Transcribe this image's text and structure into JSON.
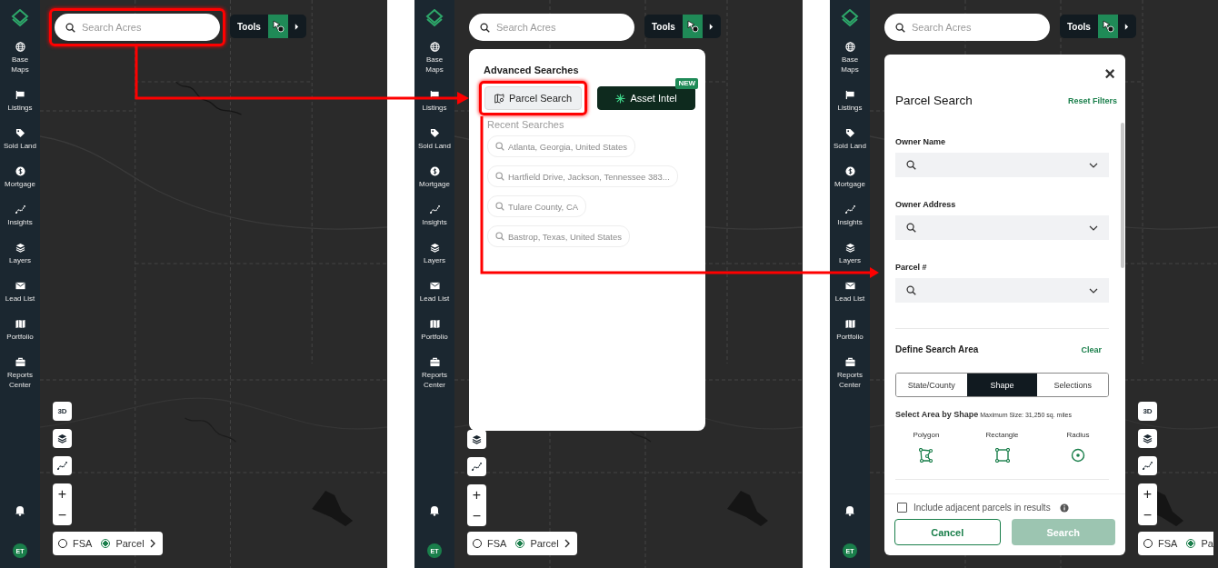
{
  "panels": [
    {
      "sidebar": {
        "items": [
          {
            "kind": "globe",
            "label": "Base Maps"
          },
          {
            "kind": "flag",
            "label": "Listings"
          },
          {
            "kind": "tag",
            "label": "Sold Land"
          },
          {
            "kind": "dollar",
            "label": "Mortgage"
          },
          {
            "kind": "insights",
            "label": "Insights"
          },
          {
            "kind": "layers",
            "label": "Layers"
          },
          {
            "kind": "mail",
            "label": "Lead List"
          },
          {
            "kind": "map",
            "label": "Portfolio"
          },
          {
            "kind": "briefcase",
            "label": "Reports Center"
          }
        ],
        "avatar": "ET"
      },
      "search": {
        "placeholder": "Search Acres",
        "highlighted": true
      },
      "tools": {
        "label": "Tools"
      },
      "map_controls": [
        {
          "kind": "perspective",
          "label": "3D"
        },
        {
          "kind": "layers"
        },
        {
          "kind": "insights"
        },
        {
          "kind": "zoom",
          "plus": "+",
          "minus": "−"
        }
      ],
      "layer_toggle": [
        {
          "label": "FSA",
          "selected": false,
          "chevron": false
        },
        {
          "label": "Parcel",
          "selected": true,
          "chevron": true
        }
      ]
    },
    {
      "sidebar": {
        "items": [
          {
            "kind": "globe",
            "label": "Base Maps"
          },
          {
            "kind": "flag",
            "label": "Listings"
          },
          {
            "kind": "tag",
            "label": "Sold Land"
          },
          {
            "kind": "dollar",
            "label": "Mortgage"
          },
          {
            "kind": "insights",
            "label": "Insights"
          },
          {
            "kind": "layers",
            "label": "Layers"
          },
          {
            "kind": "mail",
            "label": "Lead List"
          },
          {
            "kind": "map",
            "label": "Portfolio"
          },
          {
            "kind": "briefcase",
            "label": "Reports Center"
          }
        ],
        "avatar": "ET"
      },
      "search": {
        "placeholder": "Search Acres",
        "highlighted": false
      },
      "tools": {
        "label": "Tools"
      },
      "map_controls": [
        {
          "kind": "layers"
        },
        {
          "kind": "insights"
        },
        {
          "kind": "zoom",
          "plus": "+",
          "minus": "−"
        }
      ],
      "layer_toggle": [
        {
          "label": "FSA",
          "selected": false,
          "chevron": false
        },
        {
          "label": "Parcel",
          "selected": true,
          "chevron": true
        }
      ],
      "dropdown": {
        "title": "Advanced Searches",
        "buttons": [
          {
            "kind": "parcel",
            "label": "Parcel Search",
            "highlighted": true
          },
          {
            "kind": "asset",
            "label": "Asset Intel",
            "badge": "NEW",
            "highlighted": false
          }
        ],
        "recent_title": "Recent Searches",
        "recent": [
          "Atlanta, Georgia, United States",
          "Hartfield Drive, Jackson, Tennessee 383...",
          "Tulare County, CA",
          "Bastrop, Texas, United States"
        ]
      }
    },
    {
      "sidebar": {
        "items": [
          {
            "kind": "globe",
            "label": "Base Maps"
          },
          {
            "kind": "flag",
            "label": "Listings"
          },
          {
            "kind": "tag",
            "label": "Sold Land"
          },
          {
            "kind": "dollar",
            "label": "Mortgage"
          },
          {
            "kind": "insights",
            "label": "Insights"
          },
          {
            "kind": "layers",
            "label": "Layers"
          },
          {
            "kind": "mail",
            "label": "Lead List"
          },
          {
            "kind": "map",
            "label": "Portfolio"
          },
          {
            "kind": "briefcase",
            "label": "Reports Center"
          }
        ],
        "avatar": "ET"
      },
      "search": {
        "placeholder": "Search Acres",
        "highlighted": false
      },
      "tools": {
        "label": "Tools"
      },
      "map_controls": [
        {
          "kind": "perspective",
          "label": "3D"
        },
        {
          "kind": "layers"
        },
        {
          "kind": "insights"
        },
        {
          "kind": "zoom",
          "plus": "+",
          "minus": "−"
        }
      ],
      "layer_toggle": [
        {
          "label": "FSA",
          "selected": false,
          "chevron": false
        },
        {
          "label": "Pa",
          "selected": true,
          "chevron": false
        }
      ],
      "parcel_form": {
        "title": "Parcel Search",
        "reset": "Reset Filters",
        "close": "×",
        "fields": [
          {
            "label": "Owner Name"
          },
          {
            "label": "Owner Address"
          },
          {
            "label": "Parcel #"
          }
        ],
        "area_title": "Define Search Area",
        "clear": "Clear",
        "segments": [
          {
            "label": "State/County",
            "selected": false
          },
          {
            "label": "Shape",
            "selected": true
          },
          {
            "label": "Selections",
            "selected": false
          }
        ],
        "shape_note": "**Select Area by Shape** Maximum Size: 31,250 sq. miles",
        "shapes": [
          {
            "kind": "polygon",
            "label": "Polygon"
          },
          {
            "kind": "rectangle",
            "label": "Rectangle"
          },
          {
            "kind": "radius",
            "label": "Radius"
          }
        ],
        "include_adjacent": {
          "label": "Include adjacent parcels in results",
          "checked": false
        },
        "cancel": "Cancel",
        "search": {
          "label": "Search",
          "disabled": true
        }
      }
    }
  ]
}
